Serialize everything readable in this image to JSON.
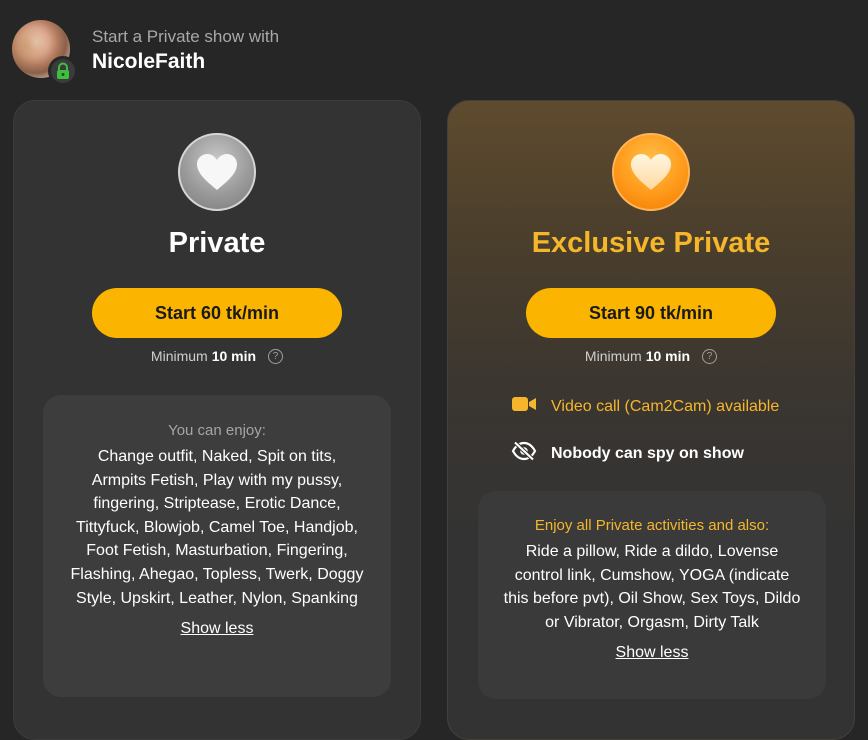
{
  "header": {
    "subtitle": "Start a Private show with",
    "model_name": "NicoleFaith",
    "avatar_icon": "avatar",
    "badge_icon": "lock-icon"
  },
  "private": {
    "icon": "heart-icon",
    "title": "Private",
    "button_label": "Start 60 tk/min",
    "minimum_label": "Minimum",
    "minimum_value": "10 min",
    "enjoy_heading": "You can enjoy:",
    "enjoy_text": "Change outfit, Naked, Spit on tits, Armpits Fetish, Play with my pussy, fingering, Striptease, Erotic Dance, Tittyfuck, Blowjob, Camel Toe, Handjob, Foot Fetish, Masturbation, Fingering, Flashing, Ahegao, Topless, Twerk, Doggy Style, Upskirt, Leather, Nylon, Spanking",
    "show_less": "Show less"
  },
  "exclusive": {
    "icon": "heart-icon",
    "title": "Exclusive Private",
    "button_label": "Start 90 tk/min",
    "minimum_label": "Minimum",
    "minimum_value": "10 min",
    "feature_video": "Video call (Cam2Cam) available",
    "feature_spy": "Nobody can spy on show",
    "enjoy_heading": "Enjoy all Private activities and also:",
    "enjoy_text": "Ride a pillow, Ride a dildo, Lovense control link, Cumshow, YOGA (indicate this before pvt), Oil Show, Sex Toys, Dildo or Vibrator, Orgasm, Dirty Talk",
    "show_less": "Show less"
  },
  "colors": {
    "accent": "#fbb500",
    "gold_text": "#f5b62b",
    "background": "#262626",
    "card": "#333333"
  }
}
